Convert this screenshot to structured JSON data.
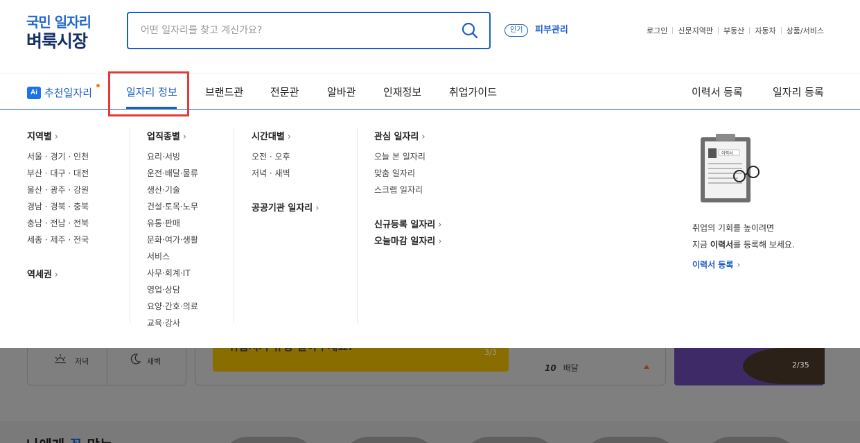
{
  "header": {
    "logo_line1": "국민 일자리",
    "logo_line2": "벼룩시장",
    "search_placeholder": "어떤 일자리를 찾고 계신가요?",
    "popular_badge": "인기",
    "popular_keyword": "피부관리",
    "util_links": [
      "로그인",
      "신문지역판",
      "부동산",
      "자동차",
      "상품/서비스"
    ]
  },
  "nav": {
    "ai_badge": "Ai",
    "ai_label": "추천일자리",
    "items": [
      "일자리 정보",
      "브랜드관",
      "전문관",
      "알바관",
      "인재정보",
      "취업가이드"
    ],
    "active_item": "일자리 정보",
    "right_items": [
      "이력서 등록",
      "일자리 등록"
    ]
  },
  "dropdown": {
    "region": {
      "title": "지역별",
      "links": [
        "서울 · 경기 · 인천",
        "부산 · 대구 · 대전",
        "울산 · 광주 · 강원",
        "경남 · 경북 · 충북",
        "충남 · 전남 · 전북",
        "세종 · 제주 · 전국"
      ],
      "station_title": "역세권"
    },
    "job_type": {
      "title": "업직종별",
      "links": [
        "요리·서빙",
        "운전·배달·물류",
        "생산·기술",
        "건설·토목·노무",
        "유통·판매",
        "문화·여가·생활",
        "서비스",
        "사무·회계·IT",
        "영업·상담",
        "요양·간호·의료",
        "교육·강사"
      ]
    },
    "time": {
      "title": "시간대별",
      "links": [
        "오전 · 오후",
        "저녁 · 새벽"
      ],
      "public_title": "공공기관 일자리"
    },
    "interest": {
      "title": "관심 일자리",
      "links": [
        "오늘 본 일자리",
        "맞춤 일자리",
        "스크랩 일자리"
      ],
      "new_title": "신규등록 일자리",
      "deadline_title": "오늘마감 일자리"
    },
    "promo": {
      "resume_label": "이력서",
      "line1": "취업의 기회를 높이려면",
      "line2_prefix": "지금 ",
      "line2_bold": "이력서",
      "line2_suffix": "를 등록해 보세요.",
      "link": "이력서 등록"
    }
  },
  "background": {
    "time_evening": "저녁",
    "time_dawn": "새벽",
    "banner_text": "취업지기 유형 알아두세요!",
    "banner_page": "3/3",
    "rank_no": "10",
    "rank_label": "배달",
    "ad_page": "2/35",
    "section_heading_prefix": "나에게 ",
    "section_heading_accent": "꼭",
    "section_heading_suffix": " 맞는"
  },
  "colors": {
    "brand_blue": "#1a5fc4",
    "logo_navy": "#152f6b",
    "highlight_red": "#e53935",
    "new_dot": "#ff7a1a"
  }
}
